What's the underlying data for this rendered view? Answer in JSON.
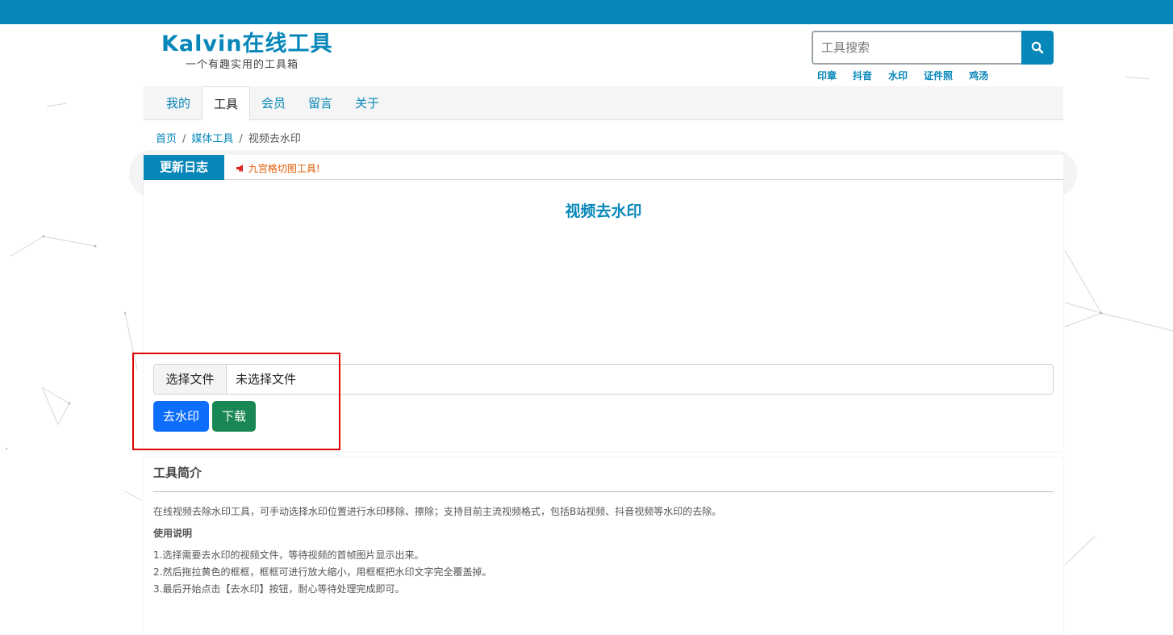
{
  "brand": {
    "title": "Kalvin在线工具",
    "subtitle": "一个有趣实用的工具箱",
    "accent_color": "#0787b9"
  },
  "search": {
    "placeholder": "工具搜索",
    "icon": "search-icon"
  },
  "quicklinks": [
    "印章",
    "抖音",
    "水印",
    "证件照",
    "鸡汤"
  ],
  "nav": {
    "items": [
      "我的",
      "工具",
      "会员",
      "留言",
      "关于"
    ],
    "active": "工具"
  },
  "breadcrumb": {
    "home": "首页",
    "category": "媒体工具",
    "current": "视频去水印"
  },
  "notice": {
    "tag": "更新日志",
    "icon": "megaphone-icon",
    "text": "九宫格切图工具!"
  },
  "tool": {
    "title": "视频去水印",
    "file_button": "选择文件",
    "file_status": "未选择文件",
    "remove_button": "去水印",
    "download_button": "下载"
  },
  "intro": {
    "title": "工具简介",
    "description": "在线视频去除水印工具，可手动选择水印位置进行水印移除、擦除；支持目前主流视频格式，包括B站视频、抖音视频等水印的去除。",
    "usage_heading": "使用说明",
    "steps": [
      "1.选择需要去水印的视频文件，等待视频的首帧图片显示出来。",
      "2.然后拖拉黄色的框框，框框可进行放大缩小，用框框把水印文字完全覆盖掉。",
      "3.最后开始点击【去水印】按钮，耐心等待处理完成即可。"
    ]
  }
}
